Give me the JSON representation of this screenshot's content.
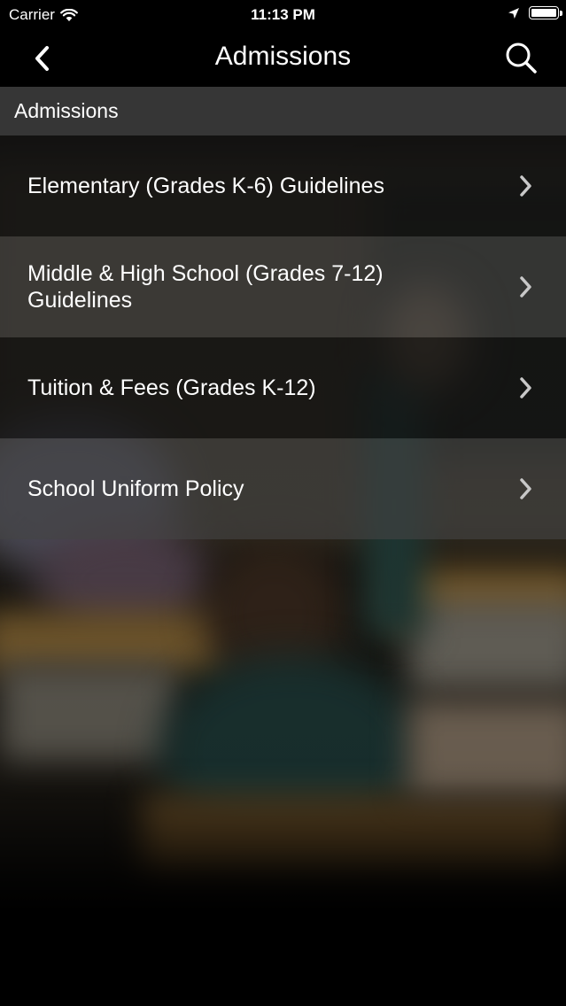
{
  "status_bar": {
    "carrier": "Carrier",
    "time": "11:13 PM"
  },
  "nav": {
    "title": "Admissions",
    "back_icon": "chevron-left-icon",
    "search_icon": "search-icon"
  },
  "section": {
    "header": "Admissions"
  },
  "menu": {
    "items": [
      {
        "label": "Elementary (Grades K-6) Guidelines"
      },
      {
        "label": "Middle & High School (Grades 7-12) Guidelines"
      },
      {
        "label": "Tuition & Fees (Grades K-12)"
      },
      {
        "label": "School Uniform Policy"
      }
    ]
  },
  "colors": {
    "bar_background": "#000000",
    "section_header": "#3a3a3a",
    "text": "#ffffff",
    "chevron": "#c8c8c8"
  }
}
